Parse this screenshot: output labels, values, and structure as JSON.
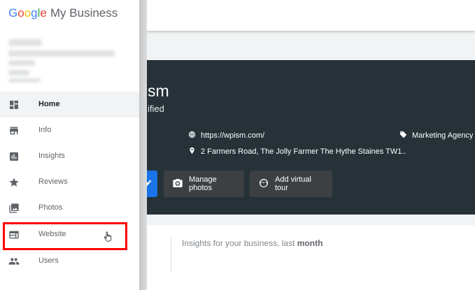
{
  "app": {
    "logo_google_letters": [
      "G",
      "o",
      "o",
      "g",
      "l",
      "e"
    ],
    "logo_google_colors": [
      "#4285F4",
      "#EA4335",
      "#FBBC05",
      "#4285F4",
      "#34A853",
      "#EA4335"
    ],
    "logo_suffix": "My Business"
  },
  "business": {
    "name_partial": "sm",
    "status_partial": "ified",
    "website": "https://wpism.com/",
    "address": "2 Farmers Road, The Jolly Farmer The Hythe Staines TW1..",
    "category": "Marketing Agency"
  },
  "actions": {
    "manage_photos": "Manage photos",
    "add_virtual_tour": "Add virtual tour"
  },
  "insights": {
    "prefix": "Insights for your business, last ",
    "period": "month"
  },
  "sidebar": {
    "items": [
      {
        "label": "Home",
        "icon": "dashboard-icon",
        "active": true
      },
      {
        "label": "Info",
        "icon": "store-icon",
        "active": false
      },
      {
        "label": "Insights",
        "icon": "insights-icon",
        "active": false
      },
      {
        "label": "Reviews",
        "icon": "star-icon",
        "active": false
      },
      {
        "label": "Photos",
        "icon": "photo-icon",
        "active": false
      },
      {
        "label": "Website",
        "icon": "website-icon",
        "active": false,
        "highlighted": true
      },
      {
        "label": "Users",
        "icon": "users-icon",
        "active": false
      }
    ]
  },
  "colors": {
    "hero_bg": "#263238",
    "primary_button": "#1a73e8",
    "highlight_box": "#ff0000",
    "active_nav_bg": "#f1f3f4"
  }
}
